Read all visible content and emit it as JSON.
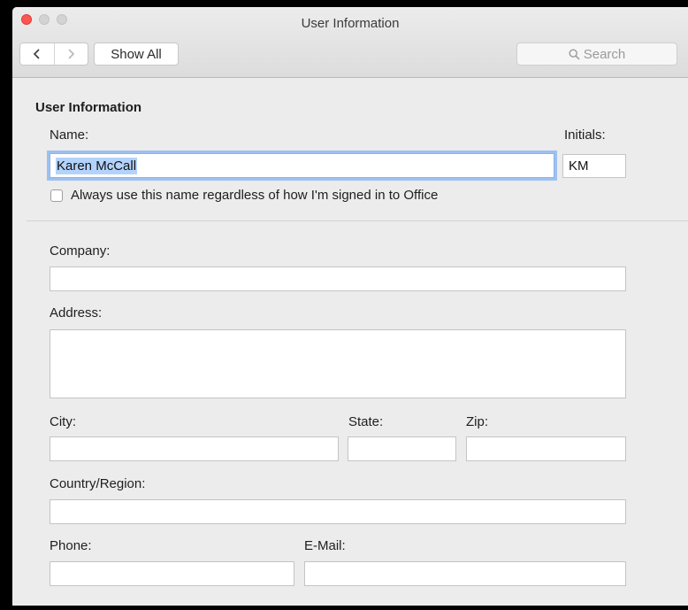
{
  "window": {
    "title": "User Information"
  },
  "toolbar": {
    "back_glyph": "<",
    "forward_glyph": ">",
    "show_all_label": "Show All",
    "search_placeholder": "Search"
  },
  "form": {
    "section_title": "User Information",
    "name_label": "Name:",
    "name_value": "Karen McCall",
    "initials_label": "Initials:",
    "initials_value": "KM",
    "always_use_label": "Always use this name regardless of how I'm signed in to Office",
    "always_use_checked": false,
    "company_label": "Company:",
    "company_value": "",
    "address_label": "Address:",
    "address_value": "",
    "city_label": "City:",
    "city_value": "",
    "state_label": "State:",
    "state_value": "",
    "zip_label": "Zip:",
    "zip_value": "",
    "country_label": "Country/Region:",
    "country_value": "",
    "phone_label": "Phone:",
    "phone_value": "",
    "email_label": "E-Mail:",
    "email_value": ""
  },
  "colors": {
    "close_button": "#fc5753",
    "focus_ring": "#9dc0f2",
    "text_selection": "#b3d3fd"
  }
}
